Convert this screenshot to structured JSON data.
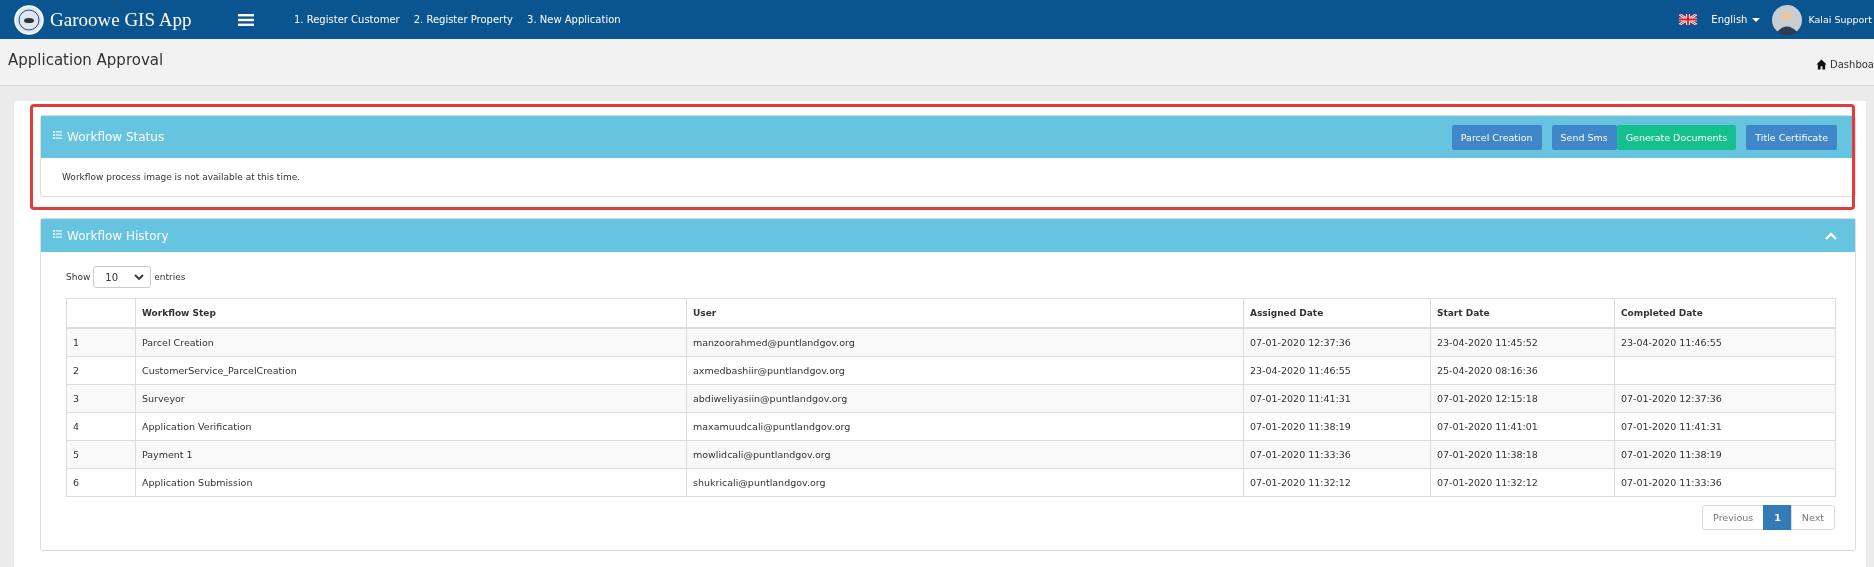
{
  "app": {
    "title": "Garoowe GIS App",
    "nav": [
      "1. Register Customer",
      "2. Register Property",
      "3. New Application"
    ],
    "language": "English",
    "user": "Kalai Support"
  },
  "page": {
    "title": "Application Approval",
    "breadcrumb": "Dashboa"
  },
  "workflow_status": {
    "title": "Workflow Status",
    "message": "Workflow process image is not available at this time.",
    "highlighted": true,
    "buttons": [
      {
        "label": "Parcel Creation",
        "kind": "primary"
      },
      {
        "label": "Send Sms",
        "kind": "primary"
      },
      {
        "label": "Generate Documents",
        "kind": "success"
      },
      {
        "label": "Title Certificate",
        "kind": "primary"
      }
    ]
  },
  "workflow_history": {
    "title": "Workflow History",
    "expanded": true,
    "show_label": "Show",
    "page_size": "10",
    "entries_label": "entries",
    "columns": [
      "",
      "Workflow Step",
      "User",
      "Assigned Date",
      "Start Date",
      "Completed Date"
    ],
    "rows": [
      [
        "1",
        "Parcel Creation",
        "manzoorahmed@puntlandgov.org",
        "07-01-2020 12:37:36",
        "23-04-2020 11:45:52",
        "23-04-2020 11:46:55"
      ],
      [
        "2",
        "CustomerService_ParcelCreation",
        "axmedbashiir@puntlandgov.org",
        "23-04-2020 11:46:55",
        "25-04-2020 08:16:36",
        ""
      ],
      [
        "3",
        "Surveyor",
        "abdiweliyasiin@puntlandgov.org",
        "07-01-2020 11:41:31",
        "07-01-2020 12:15:18",
        "07-01-2020 12:37:36"
      ],
      [
        "4",
        "Application Verification",
        "maxamuudcali@puntlandgov.org",
        "07-01-2020 11:38:19",
        "07-01-2020 11:41:01",
        "07-01-2020 11:41:31"
      ],
      [
        "5",
        "Payment 1",
        "mowlidcali@puntlandgov.org",
        "07-01-2020 11:33:36",
        "07-01-2020 11:38:18",
        "07-01-2020 11:38:19"
      ],
      [
        "6",
        "Application Submission",
        "shukricali@puntlandgov.org",
        "07-01-2020 11:32:12",
        "07-01-2020 11:32:12",
        "07-01-2020 11:33:36"
      ]
    ],
    "pagination": [
      {
        "label": "Previous",
        "selected": false
      },
      {
        "label": "1",
        "selected": true
      },
      {
        "label": "Next",
        "selected": false
      }
    ]
  }
}
